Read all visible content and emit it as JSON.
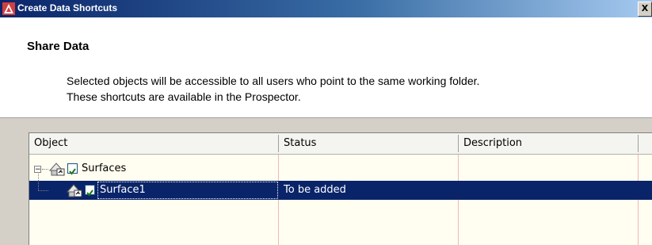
{
  "window": {
    "title": "Create Data Shortcuts",
    "close_label": "X"
  },
  "header": {
    "heading": "Share Data",
    "description_line1": "Selected objects will be accessible to all users who point to the same working folder.",
    "description_line2": "These shortcuts are available in the Prospector."
  },
  "table": {
    "columns": [
      "Object",
      "Status",
      "Description"
    ],
    "rows": [
      {
        "object": "Surfaces",
        "status": "",
        "description": "",
        "checked": true,
        "expanded": true,
        "toggle": "−"
      },
      {
        "object": "Surface1",
        "status": "To be added",
        "description": "",
        "checked": true,
        "selected": true
      }
    ]
  },
  "colors": {
    "selection": "#0a246a",
    "grid_background": "#fffef0",
    "titlebar_start": "#0a246a",
    "titlebar_end": "#a6caf0"
  },
  "icons": [
    "app-icon",
    "close-icon",
    "tree-collapse-icon",
    "surface-shortcut-icon",
    "checkbox-checked-icon"
  ]
}
